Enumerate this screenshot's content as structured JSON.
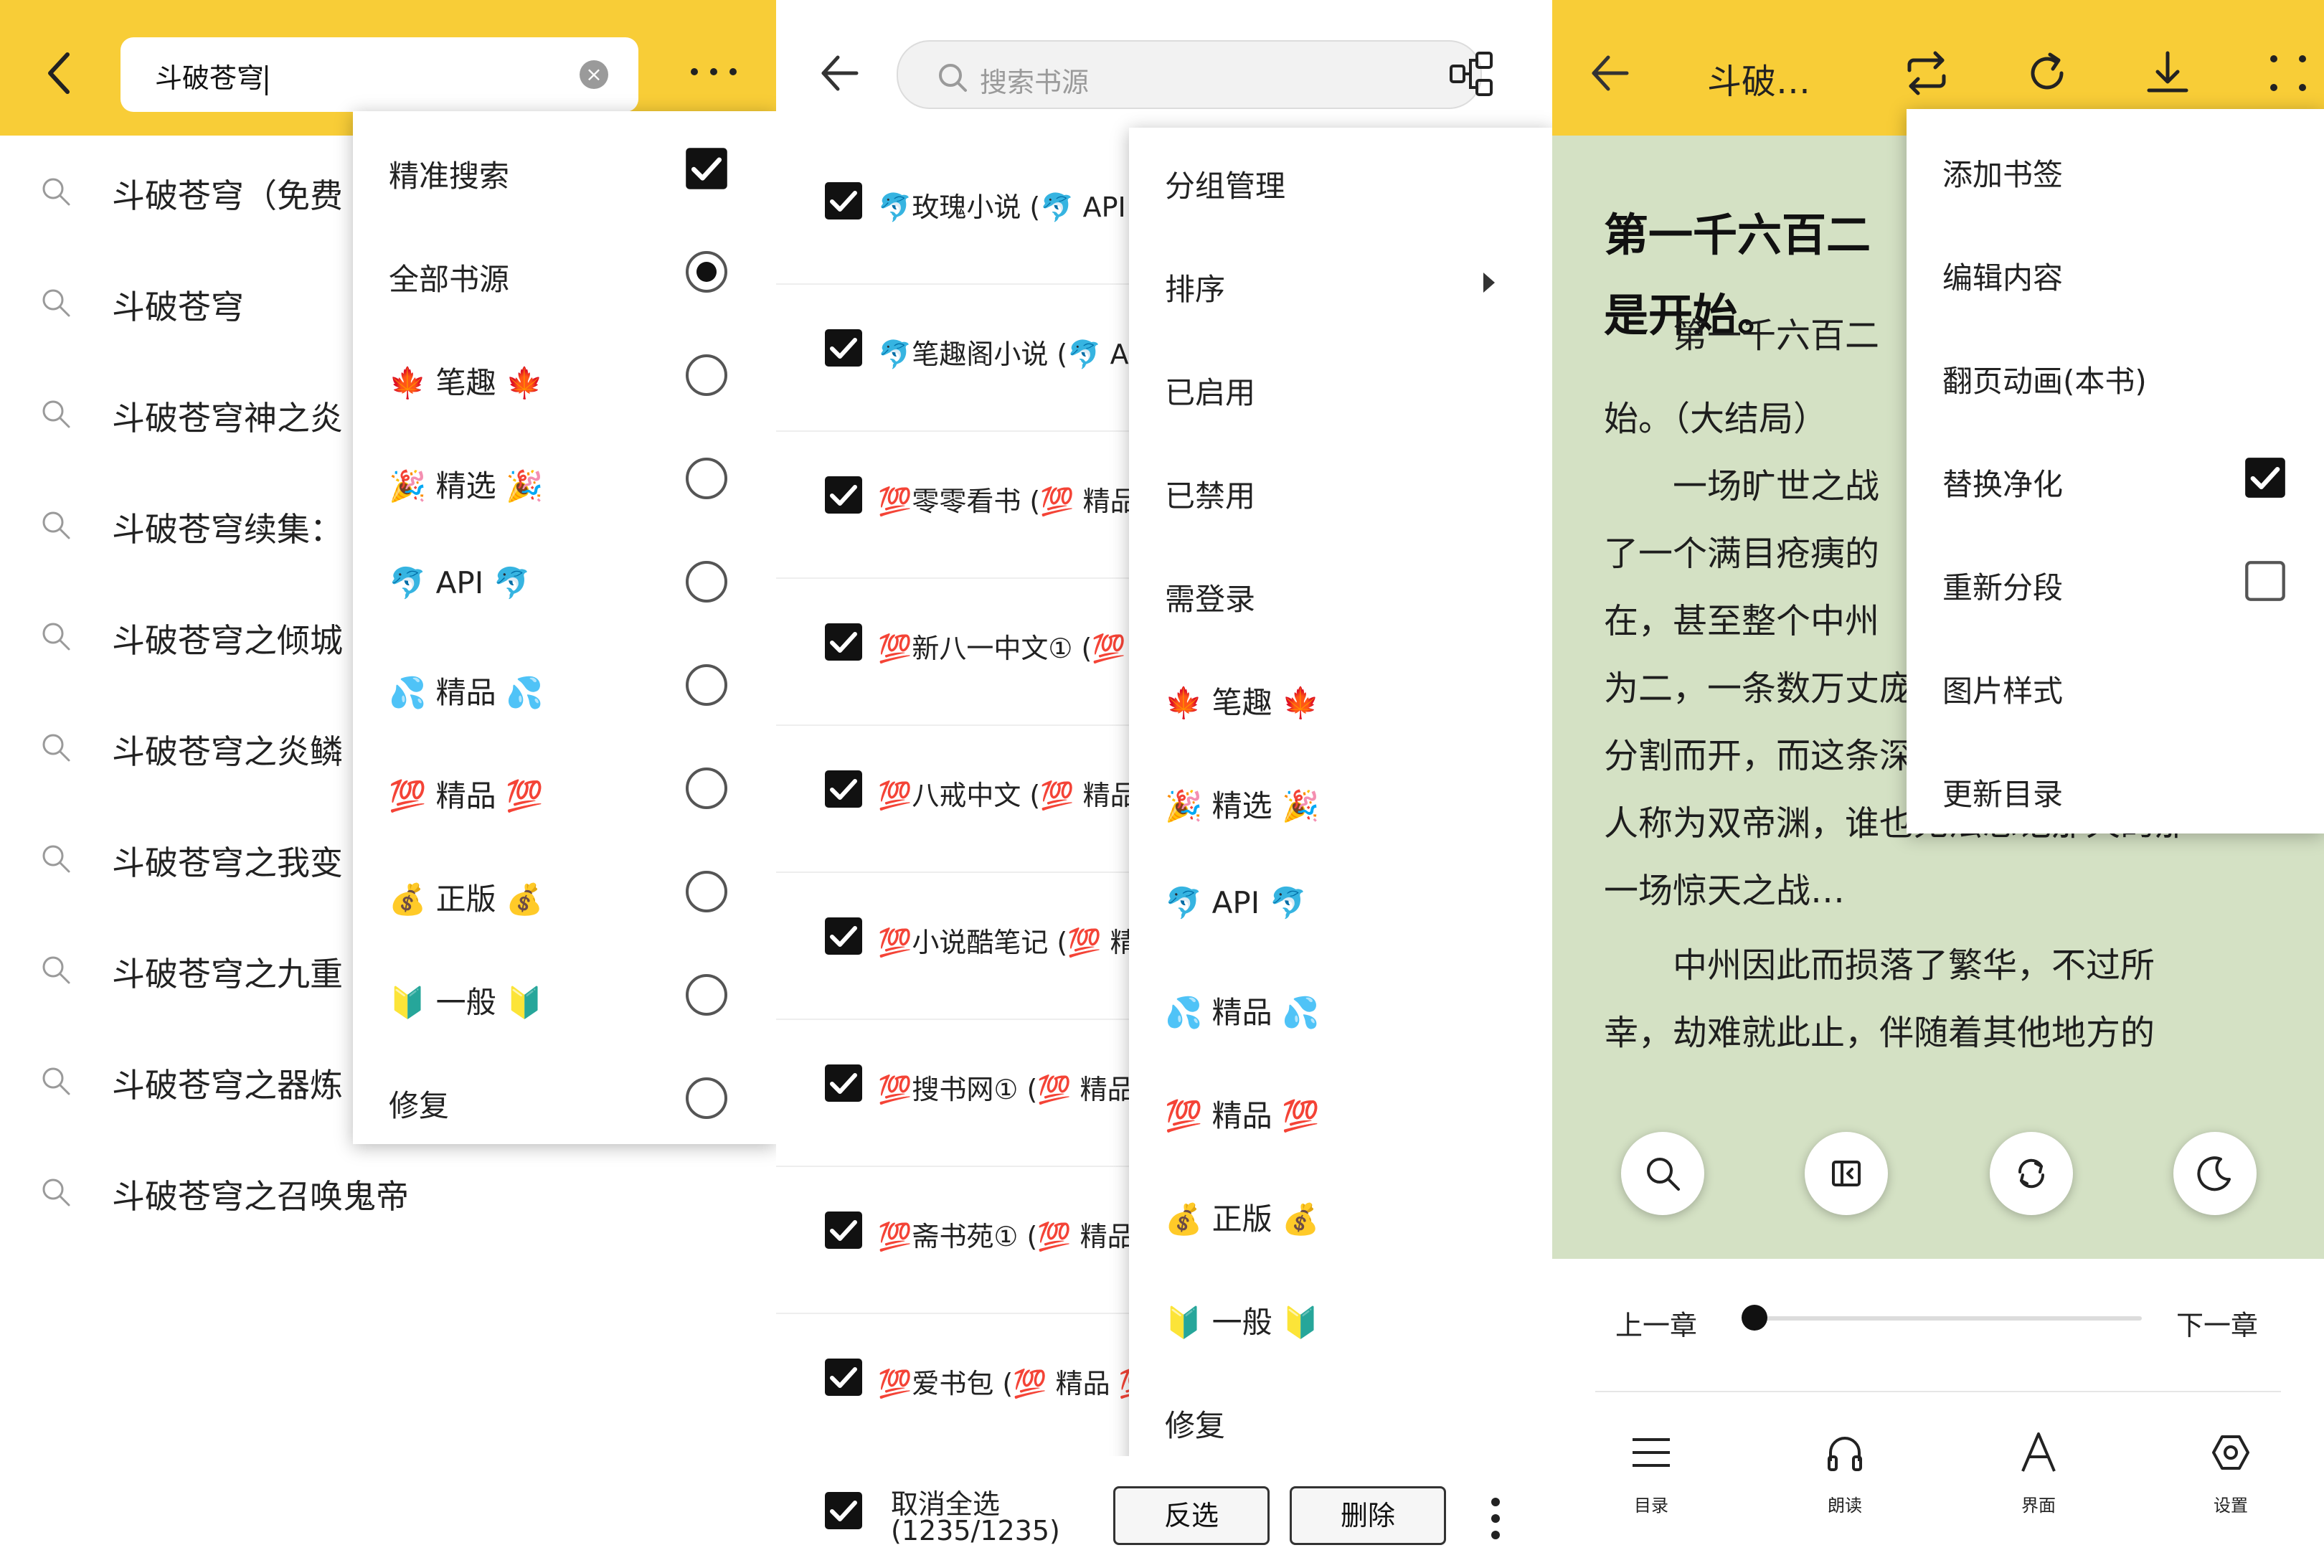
{
  "search_screen": {
    "query": "斗破苍穹",
    "suggestions": [
      "斗破苍穹（免费",
      "斗破苍穹",
      "斗破苍穹神之炎",
      "斗破苍穹续集：",
      "斗破苍穹之倾城",
      "斗破苍穹之炎鳞",
      "斗破苍穹之我变",
      "斗破苍穹之九重",
      "斗破苍穹之器炼",
      "斗破苍穹之召唤鬼帝"
    ],
    "menu": [
      {
        "label": "精准搜索",
        "control": "checkbox",
        "checked": true
      },
      {
        "label": "全部书源",
        "control": "radio",
        "checked": true
      },
      {
        "label": "🍁 笔趣 🍁",
        "control": "radio",
        "checked": false
      },
      {
        "label": "🎉 精选 🎉",
        "control": "radio",
        "checked": false
      },
      {
        "label": "🐬 API 🐬",
        "control": "radio",
        "checked": false
      },
      {
        "label": "💦 精品 💦",
        "control": "radio",
        "checked": false
      },
      {
        "label": "💯 精品 💯",
        "control": "radio",
        "checked": false
      },
      {
        "label": "💰 正版 💰",
        "control": "radio",
        "checked": false
      },
      {
        "label": "🔰 一般 🔰",
        "control": "radio",
        "checked": false
      },
      {
        "label": "修复",
        "control": "radio",
        "checked": false
      }
    ]
  },
  "source_screen": {
    "search_placeholder": "搜索书源",
    "sources": [
      "🐬玫瑰小说 (🐬 API",
      "🐬笔趣阁小说 (🐬 A",
      "💯零零看书 (💯 精品",
      "💯新八一中文① (💯",
      "💯八戒中文 (💯 精品",
      "💯小说酷笔记 (💯 精",
      "💯搜书网① (💯 精品",
      "💯斋书苑① (💯 精品",
      "💯爱书包 (💯 精品 💯"
    ],
    "footer": {
      "select_label": "取消全选",
      "count": "(1235/1235)",
      "invert_label": "反选",
      "delete_label": "删除"
    },
    "menu": [
      "分组管理",
      "排序",
      "已启用",
      "已禁用",
      "需登录",
      "🍁 笔趣 🍁",
      "🎉 精选 🎉",
      "🐬 API 🐬",
      "💦 精品 💦",
      "💯 精品 💯",
      "💰 正版 💰",
      "🔰 一般 🔰",
      "修复"
    ]
  },
  "reader_screen": {
    "title": "斗破…",
    "chapter_title_line1": "第一千六百二",
    "chapter_title_line2": "是开始。",
    "paragraphs": [
      "　　第一千六百二",
      "始。（大结局）",
      "　　一场旷世之战",
      "了一个满目疮痍的",
      "在，甚至整个中州",
      "为二，一条数万丈庞大的深渊，将两地",
      "分割而开，而这条深渊，在日后，也被",
      "人称为双帝渊，谁也无法忘记那天的那",
      "一场惊天之战…",
      "　　中州因此而损落了繁华，不过所",
      "幸，劫难就此止，伴随着其他地方的"
    ],
    "menu": [
      {
        "label": "添加书签"
      },
      {
        "label": "编辑内容"
      },
      {
        "label": "翻页动画(本书)"
      },
      {
        "label": "替换净化",
        "checkbox": true,
        "checked": true
      },
      {
        "label": "重新分段",
        "checkbox": true,
        "checked": false
      },
      {
        "label": "图片样式"
      },
      {
        "label": "更新目录"
      }
    ],
    "prev_chapter": "上一章",
    "next_chapter": "下一章",
    "progress": 0.0,
    "toolbar": [
      "目录",
      "朗读",
      "界面",
      "设置"
    ]
  },
  "colors": {
    "accent_yellow": "#f8cd37",
    "reading_bg": "#d4e1c4"
  }
}
